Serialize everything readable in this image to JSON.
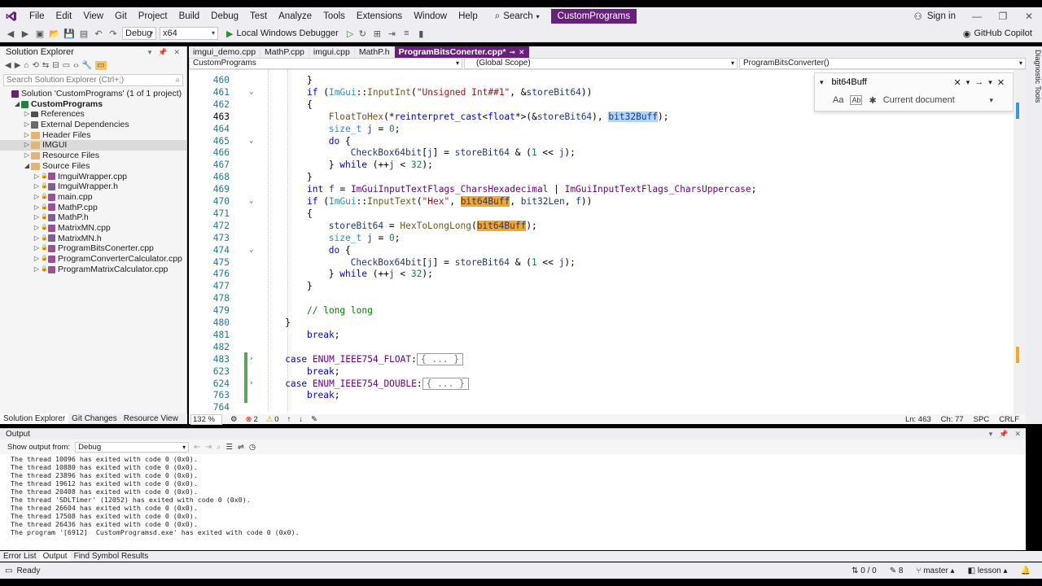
{
  "menu": [
    "File",
    "Edit",
    "View",
    "Git",
    "Project",
    "Build",
    "Debug",
    "Test",
    "Analyze",
    "Tools",
    "Extensions",
    "Window",
    "Help"
  ],
  "search_label": "Search",
  "app_title": "CustomPrograms",
  "sign_in": "Sign in",
  "toolbar": {
    "config": "Debug",
    "platform": "x64",
    "debugger": "Local Windows Debugger",
    "copilot": "GitHub Copilot"
  },
  "solution_explorer": {
    "title": "Solution Explorer",
    "search_placeholder": "Search Solution Explorer (Ctrl+;)",
    "items": [
      {
        "label": "Solution 'CustomPrograms' (1 of 1 project)",
        "indent": 0,
        "icon": "sln"
      },
      {
        "label": "CustomPrograms",
        "indent": 1,
        "icon": "proj",
        "bold": true
      },
      {
        "label": "References",
        "indent": 2,
        "icon": "ref"
      },
      {
        "label": "External Dependencies",
        "indent": 2,
        "icon": "ext"
      },
      {
        "label": "Header Files",
        "indent": 2,
        "icon": "folder"
      },
      {
        "label": "IMGUI",
        "indent": 2,
        "icon": "folder"
      },
      {
        "label": "Resource Files",
        "indent": 2,
        "icon": "folder"
      },
      {
        "label": "Source Files",
        "indent": 2,
        "icon": "folder"
      },
      {
        "label": "ImguiWrapper.cpp",
        "indent": 3,
        "icon": "cpp"
      },
      {
        "label": "ImguiWrapper.h",
        "indent": 3,
        "icon": "h"
      },
      {
        "label": "main.cpp",
        "indent": 3,
        "icon": "cpp"
      },
      {
        "label": "MathP.cpp",
        "indent": 3,
        "icon": "cpp"
      },
      {
        "label": "MathP.h",
        "indent": 3,
        "icon": "h"
      },
      {
        "label": "MatrixMN.cpp",
        "indent": 3,
        "icon": "cpp"
      },
      {
        "label": "MatrixMN.h",
        "indent": 3,
        "icon": "h"
      },
      {
        "label": "ProgramBitsConerter.cpp",
        "indent": 3,
        "icon": "cpp"
      },
      {
        "label": "ProgramConverterCalculator.cpp",
        "indent": 3,
        "icon": "cpp"
      },
      {
        "label": "ProgramMatrixCalculator.cpp",
        "indent": 3,
        "icon": "cpp"
      }
    ],
    "tabs": [
      "Solution Explorer",
      "Git Changes",
      "Resource View"
    ]
  },
  "doc_tabs": [
    "imgui_demo.cpp",
    "MathP.cpp",
    "imgui.cpp",
    "MathP.h",
    "ProgramBitsConerter.cpp*"
  ],
  "nav": {
    "project": "CustomPrograms",
    "scope": "(Global Scope)",
    "member": "ProgramBitsConverter()"
  },
  "find": {
    "query": "bit64Buff",
    "scope": "Current document",
    "case_label": "Aa",
    "word_label": "Ab"
  },
  "code_lines": [
    {
      "n": "460",
      "html": "        <span>}</span>"
    },
    {
      "n": "461",
      "html": "        <span class=\"kw\">if</span> (<span class=\"ty\">ImGui</span>::<span class=\"fn\">InputInt</span>(<span class=\"str\">\"Unsigned Int##1\"</span>, &amp;<span class=\"var\">storeBit64</span>))"
    },
    {
      "n": "462",
      "html": "        {"
    },
    {
      "n": "463",
      "html": "            <span class=\"fn\">FloatToHex</span>(*<span class=\"kw\">reinterpret_cast</span>&lt;<span class=\"kw\">float</span>*&gt;(&amp;<span class=\"var\">storeBit64</span>), <span class=\"hl-sel var\">bit32Buff</span>);"
    },
    {
      "n": "464",
      "html": "            <span class=\"ty\">size_t</span> <span class=\"var\">j</span> = <span class=\"num\">0</span>;"
    },
    {
      "n": "465",
      "html": "            <span class=\"kw\">do</span> {"
    },
    {
      "n": "466",
      "html": "                <span class=\"var\">CheckBox64bit</span>[<span class=\"var\">j</span>] = <span class=\"var\">storeBit64</span> &amp; (<span class=\"num\">1</span> &lt;&lt; <span class=\"var\">j</span>);"
    },
    {
      "n": "467",
      "html": "            } <span class=\"kw\">while</span> (++<span class=\"var\">j</span> &lt; <span class=\"num\">32</span>);"
    },
    {
      "n": "468",
      "html": "        }"
    },
    {
      "n": "469",
      "html": "        <span class=\"kw\">int</span> <span class=\"var\">f</span> = <span class=\"mac\">ImGuiInputTextFlags_CharsHexadecimal</span> | <span class=\"mac\">ImGuiInputTextFlags_CharsUppercase</span>;"
    },
    {
      "n": "470",
      "html": "        <span class=\"kw\">if</span> (<span class=\"ty\">ImGui</span>::<span class=\"fn\">InputText</span>(<span class=\"str\">\"Hex\"</span>, <span class=\"hl-orange var\">bit64Buff</span>, <span class=\"var\">bit32Len</span>, <span class=\"var\">f</span>))"
    },
    {
      "n": "471",
      "html": "        {"
    },
    {
      "n": "472",
      "html": "            <span class=\"var\">storeBit64</span> = <span class=\"fn\">HexToLongLong</span>(<span class=\"hl-orange var\">bit64Buff</span>);"
    },
    {
      "n": "473",
      "html": "            <span class=\"ty\">size_t</span> <span class=\"var\">j</span> = <span class=\"num\">0</span>;"
    },
    {
      "n": "474",
      "html": "            <span class=\"kw\">do</span> {"
    },
    {
      "n": "475",
      "html": "                <span class=\"var\">CheckBox64bit</span>[<span class=\"var\">j</span>] = <span class=\"var\">storeBit64</span> &amp; (<span class=\"num\">1</span> &lt;&lt; <span class=\"var\">j</span>);"
    },
    {
      "n": "476",
      "html": "            } <span class=\"kw\">while</span> (++<span class=\"var\">j</span> &lt; <span class=\"num\">32</span>);"
    },
    {
      "n": "477",
      "html": "        }"
    },
    {
      "n": "478",
      "html": ""
    },
    {
      "n": "479",
      "html": "        <span class=\"cm\">// long long</span>"
    },
    {
      "n": "480",
      "html": "    }"
    },
    {
      "n": "481",
      "html": "        <span class=\"kw\">break</span>;"
    },
    {
      "n": "482",
      "html": ""
    },
    {
      "n": "483",
      "html": "    <span class=\"kw\">case</span> <span class=\"mac\">ENUM_IEEE754_FLOAT</span>:<span class=\"ellip\">{ ... }</span>"
    },
    {
      "n": "623",
      "html": "        <span class=\"kw\">break</span>;"
    },
    {
      "n": "624",
      "html": "    <span class=\"kw\">case</span> <span class=\"mac\">ENUM_IEEE754_DOUBLE</span>:<span class=\"ellip\">{ ... }</span>"
    },
    {
      "n": "763",
      "html": "        <span class=\"kw\">break</span>;"
    },
    {
      "n": "764",
      "html": ""
    }
  ],
  "editor_status": {
    "zoom": "132 %",
    "errors": "2",
    "warnings": "0",
    "ln": "Ln: 463",
    "ch": "Ch: 77",
    "enc": "SPC",
    "eol": "CRLF"
  },
  "output": {
    "title": "Output",
    "show_from_label": "Show output from:",
    "source": "Debug",
    "lines": [
      "The thread 10096 has exited with code 0 (0x0).",
      "The thread 10880 has exited with code 0 (0x0).",
      "The thread 23896 has exited with code 0 (0x0).",
      "The thread 19612 has exited with code 0 (0x0).",
      "The thread 20408 has exited with code 0 (0x0).",
      "The thread 'SDLTimer' (12052) has exited with code 0 (0x0).",
      "The thread 26604 has exited with code 0 (0x0).",
      "The thread 17508 has exited with code 0 (0x0).",
      "The thread 26436 has exited with code 0 (0x0).",
      "The program '[6912]  CustomProgramsd.exe' has exited with code 0 (0x0)."
    ]
  },
  "bottom_tabs": [
    "Error List",
    "Output",
    "Find Symbol Results"
  ],
  "diag_tools": "Diagnostic Tools",
  "status": {
    "ready": "Ready",
    "lines": "0 / 0",
    "pen": "8",
    "branch": "master",
    "repo": "lesson"
  }
}
